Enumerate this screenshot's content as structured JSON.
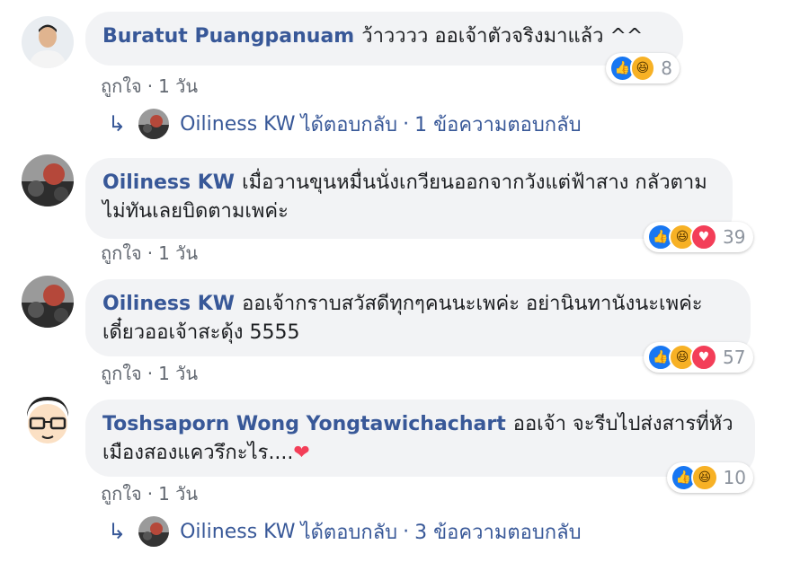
{
  "comments": [
    {
      "name": "Buratut Puangpanuam",
      "text": "ว้าวววว ออเจ้าตัวจริงมาแล้ว ^^",
      "like_label": "ถูกใจ",
      "time": "1 วัน",
      "reaction_count": "8",
      "reactions": [
        "like",
        "haha"
      ]
    },
    {
      "name": "Oiliness KW",
      "text": "เมื่อวานขุนหมื่นนั่งเกวียนออกจากวังแต่ฟ้าสาง กลัวตามไม่ทันเลยบิดตามเพค่ะ",
      "like_label": "ถูกใจ",
      "time": "1 วัน",
      "reaction_count": "39",
      "reactions": [
        "like",
        "haha",
        "love"
      ]
    },
    {
      "name": "Oiliness KW",
      "text": "ออเจ้ากราบสวัสดีทุกๆคนนะเพค่ะ อย่านินทานังนะเพค่ะ เดี๋ยวออเจ้าสะดุ้ง 5555",
      "like_label": "ถูกใจ",
      "time": "1 วัน",
      "reaction_count": "57",
      "reactions": [
        "like",
        "haha",
        "love"
      ]
    },
    {
      "name": "Toshsaporn Wong Yongtawichachart",
      "text": "ออเจ้า จะรีบไปส่งสารที่หัวเมืองสองแควรึกะไร....",
      "emoji": "❤",
      "like_label": "ถูกใจ",
      "time": "1 วัน",
      "reaction_count": "10",
      "reactions": [
        "like",
        "haha"
      ]
    }
  ],
  "replies": [
    {
      "name": "Oiliness KW",
      "verb": "ได้ตอบกลับ",
      "count": "1 ข้อความตอบกลับ"
    },
    {
      "name": "Oiliness KW",
      "verb": "ได้ตอบกลับ",
      "count": "3 ข้อความตอบกลับ"
    }
  ],
  "colors": {
    "name": "#385898",
    "bubble": "#f2f3f5",
    "meta": "#616770",
    "like_reaction": "#1877f2",
    "haha_reaction": "#f7b125",
    "love_reaction": "#f33e58"
  },
  "icons": {
    "reply_arrow": "reply-arrow-icon",
    "like": "like-reaction-icon",
    "haha": "haha-reaction-icon",
    "love": "love-reaction-icon"
  }
}
